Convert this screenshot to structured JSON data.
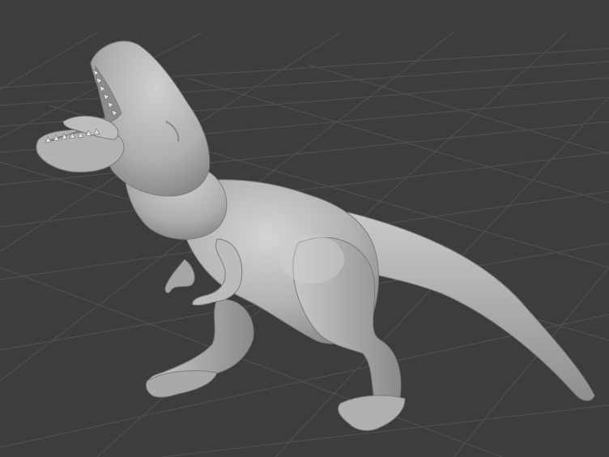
{
  "viewport": {
    "background_color": "#3d3d3d",
    "grid_color": "#4f4f4f",
    "model_color": "#b4b4b4",
    "model_shadow_color": "#7e7e7e",
    "model_highlight_color": "#d2d2d2",
    "model_subject": "t-rex"
  }
}
